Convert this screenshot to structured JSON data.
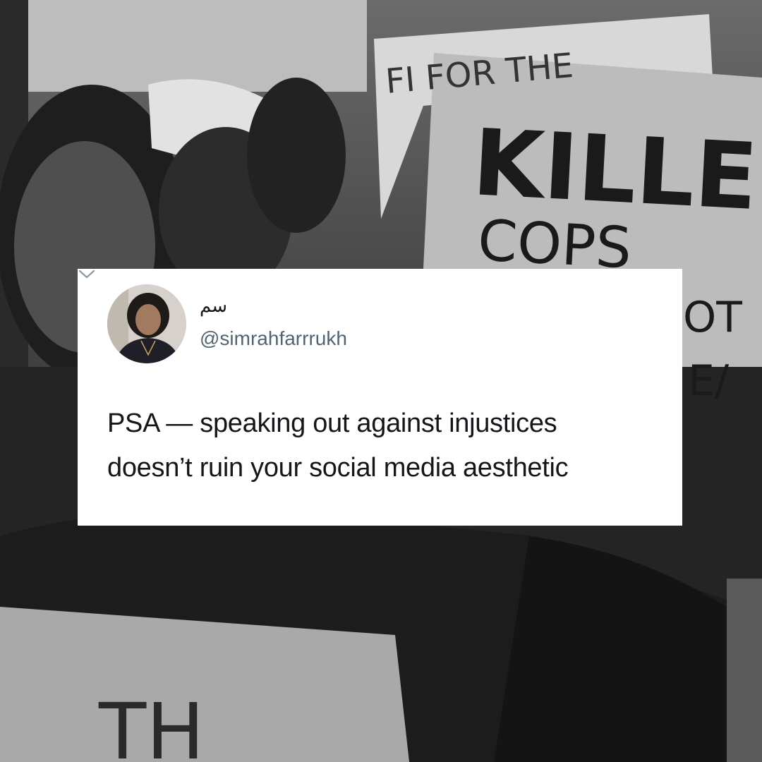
{
  "background": {
    "description_icon": "protest-photo-background",
    "signs": {
      "top_fragment": "FI   FOR THE",
      "main_line1": "KILLER",
      "main_line2": "COPS",
      "right_fragment1": "OT",
      "right_fragment2": "E/",
      "bottom_fragment": "TH"
    }
  },
  "tweet": {
    "display_name": "سم",
    "handle": "@simrahfarrrukh",
    "text_lines": [
      "PSA — speaking out against injustices",
      "doesn’t ruin your social media aesthetic"
    ],
    "menu_icon": "chevron-down-icon"
  },
  "colors": {
    "card_bg": "#ffffff",
    "text_primary": "#14171a",
    "text_secondary": "#536471"
  }
}
